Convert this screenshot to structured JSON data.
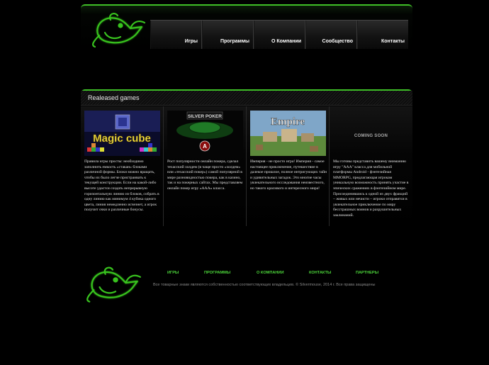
{
  "nav": {
    "items": [
      "Игры",
      "Программы",
      "О Компании",
      "Сообщество",
      "Контакты"
    ]
  },
  "released": {
    "title": "Realeased games",
    "games": [
      {
        "name": "Magic cube",
        "thumb_text": "Magic cube",
        "description": "Правила игры просты: необходимо заполнить емкость «стакан» блоками различной формы. Блоки можно вращать, чтобы их было легче пристраивать к текущей конструкции. Если на какой-либо высоте удастся создать непрерывную горизонтальную линию из блоков, собрать в одну линию как минимум 4 кубика одного цвета, линия немедленно исчезнет, а игрок получит очки и различные бонусы."
      },
      {
        "name": "Silver Poker",
        "thumb_text": "SILVER POKER",
        "description": "Рост популярности онлайн покера, сделал техасский холдем (в чаще просто «холдем» или «техасский покер») самой популярной в мире разновидностью покера, как в казино, так и на покерных сайтах. Мы представляем онлайн покер игру «AAA» класса."
      },
      {
        "name": "Empire",
        "thumb_text": "Empire",
        "description": "Империя - не просто игра! Империя - самое настоящее приключение, путешествие в далекое прошлое, полное интригующих тайн и удивительных загадок. Это многие часы увлекательного исследования неизвестного, но такого красивого и интересного мира!"
      },
      {
        "name": "Coming soon",
        "thumb_text": "COMING SOON",
        "description": "Мы готовы представить вашему вниманию игру \"AAA\" класса для мобильной платформы Android - фэнтезийная MMORPG, предлагающая игрокам уникальную возможность принять участие в эпических сражениях в фэнтезийном мире. Присоединившись к одной из двух фракций – живых или нечисти – игроки отправятся в увлекательное приключение по миру бесстрашных воинов и разрушительных заклинаний."
      }
    ]
  },
  "footer": {
    "links": [
      "ИГРЫ",
      "ПРОГРАММЫ",
      "О КОМПАНИИ",
      "КОНТАКТЫ",
      "ПАРТНЕРЫ"
    ],
    "copyright": "Все товарные знаки являются собственностью соответствующих владельцев. © Silvermouse, 2014 г. Все права защищены"
  },
  "colors": {
    "accent": "#3fbf27",
    "link": "#4cd43a"
  }
}
